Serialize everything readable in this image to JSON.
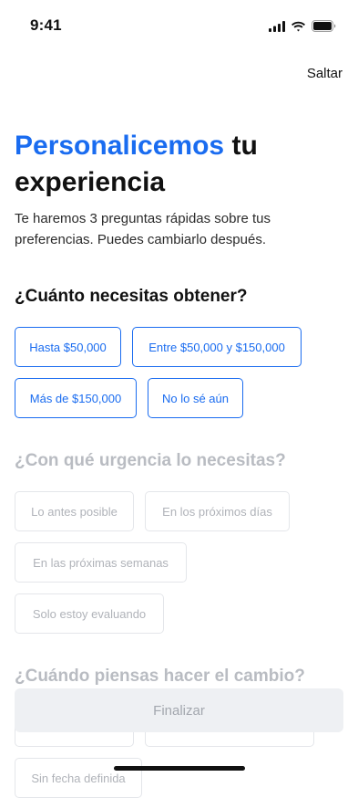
{
  "status": {
    "time": "9:41"
  },
  "header": {
    "skip_label": "Saltar"
  },
  "title": {
    "accent": "Personalicemos",
    "rest": "tu experiencia"
  },
  "subtitle": "Te haremos 3 preguntas rápidas sobre tus preferencias. Puedes cambiarlo después.",
  "questions": [
    {
      "title": "¿Cuánto necesitas obtener?",
      "options": [
        "Hasta $50,000",
        "Entre $50,000 y $150,000",
        "Más de $150,000",
        "No lo sé aún"
      ]
    },
    {
      "title": "¿Con qué urgencia lo necesitas?",
      "options": [
        "Lo antes posible",
        "En los próximos días",
        "En las próximas semanas",
        "Solo estoy evaluando"
      ]
    },
    {
      "title": "¿Cuándo piensas hacer el cambio?",
      "options": [
        "",
        "",
        "Sin fecha definida"
      ]
    }
  ],
  "footer": {
    "finish_label": "Finalizar"
  },
  "colors": {
    "accent": "#1a6cf0",
    "disabled_text": "#b9bcc2"
  }
}
